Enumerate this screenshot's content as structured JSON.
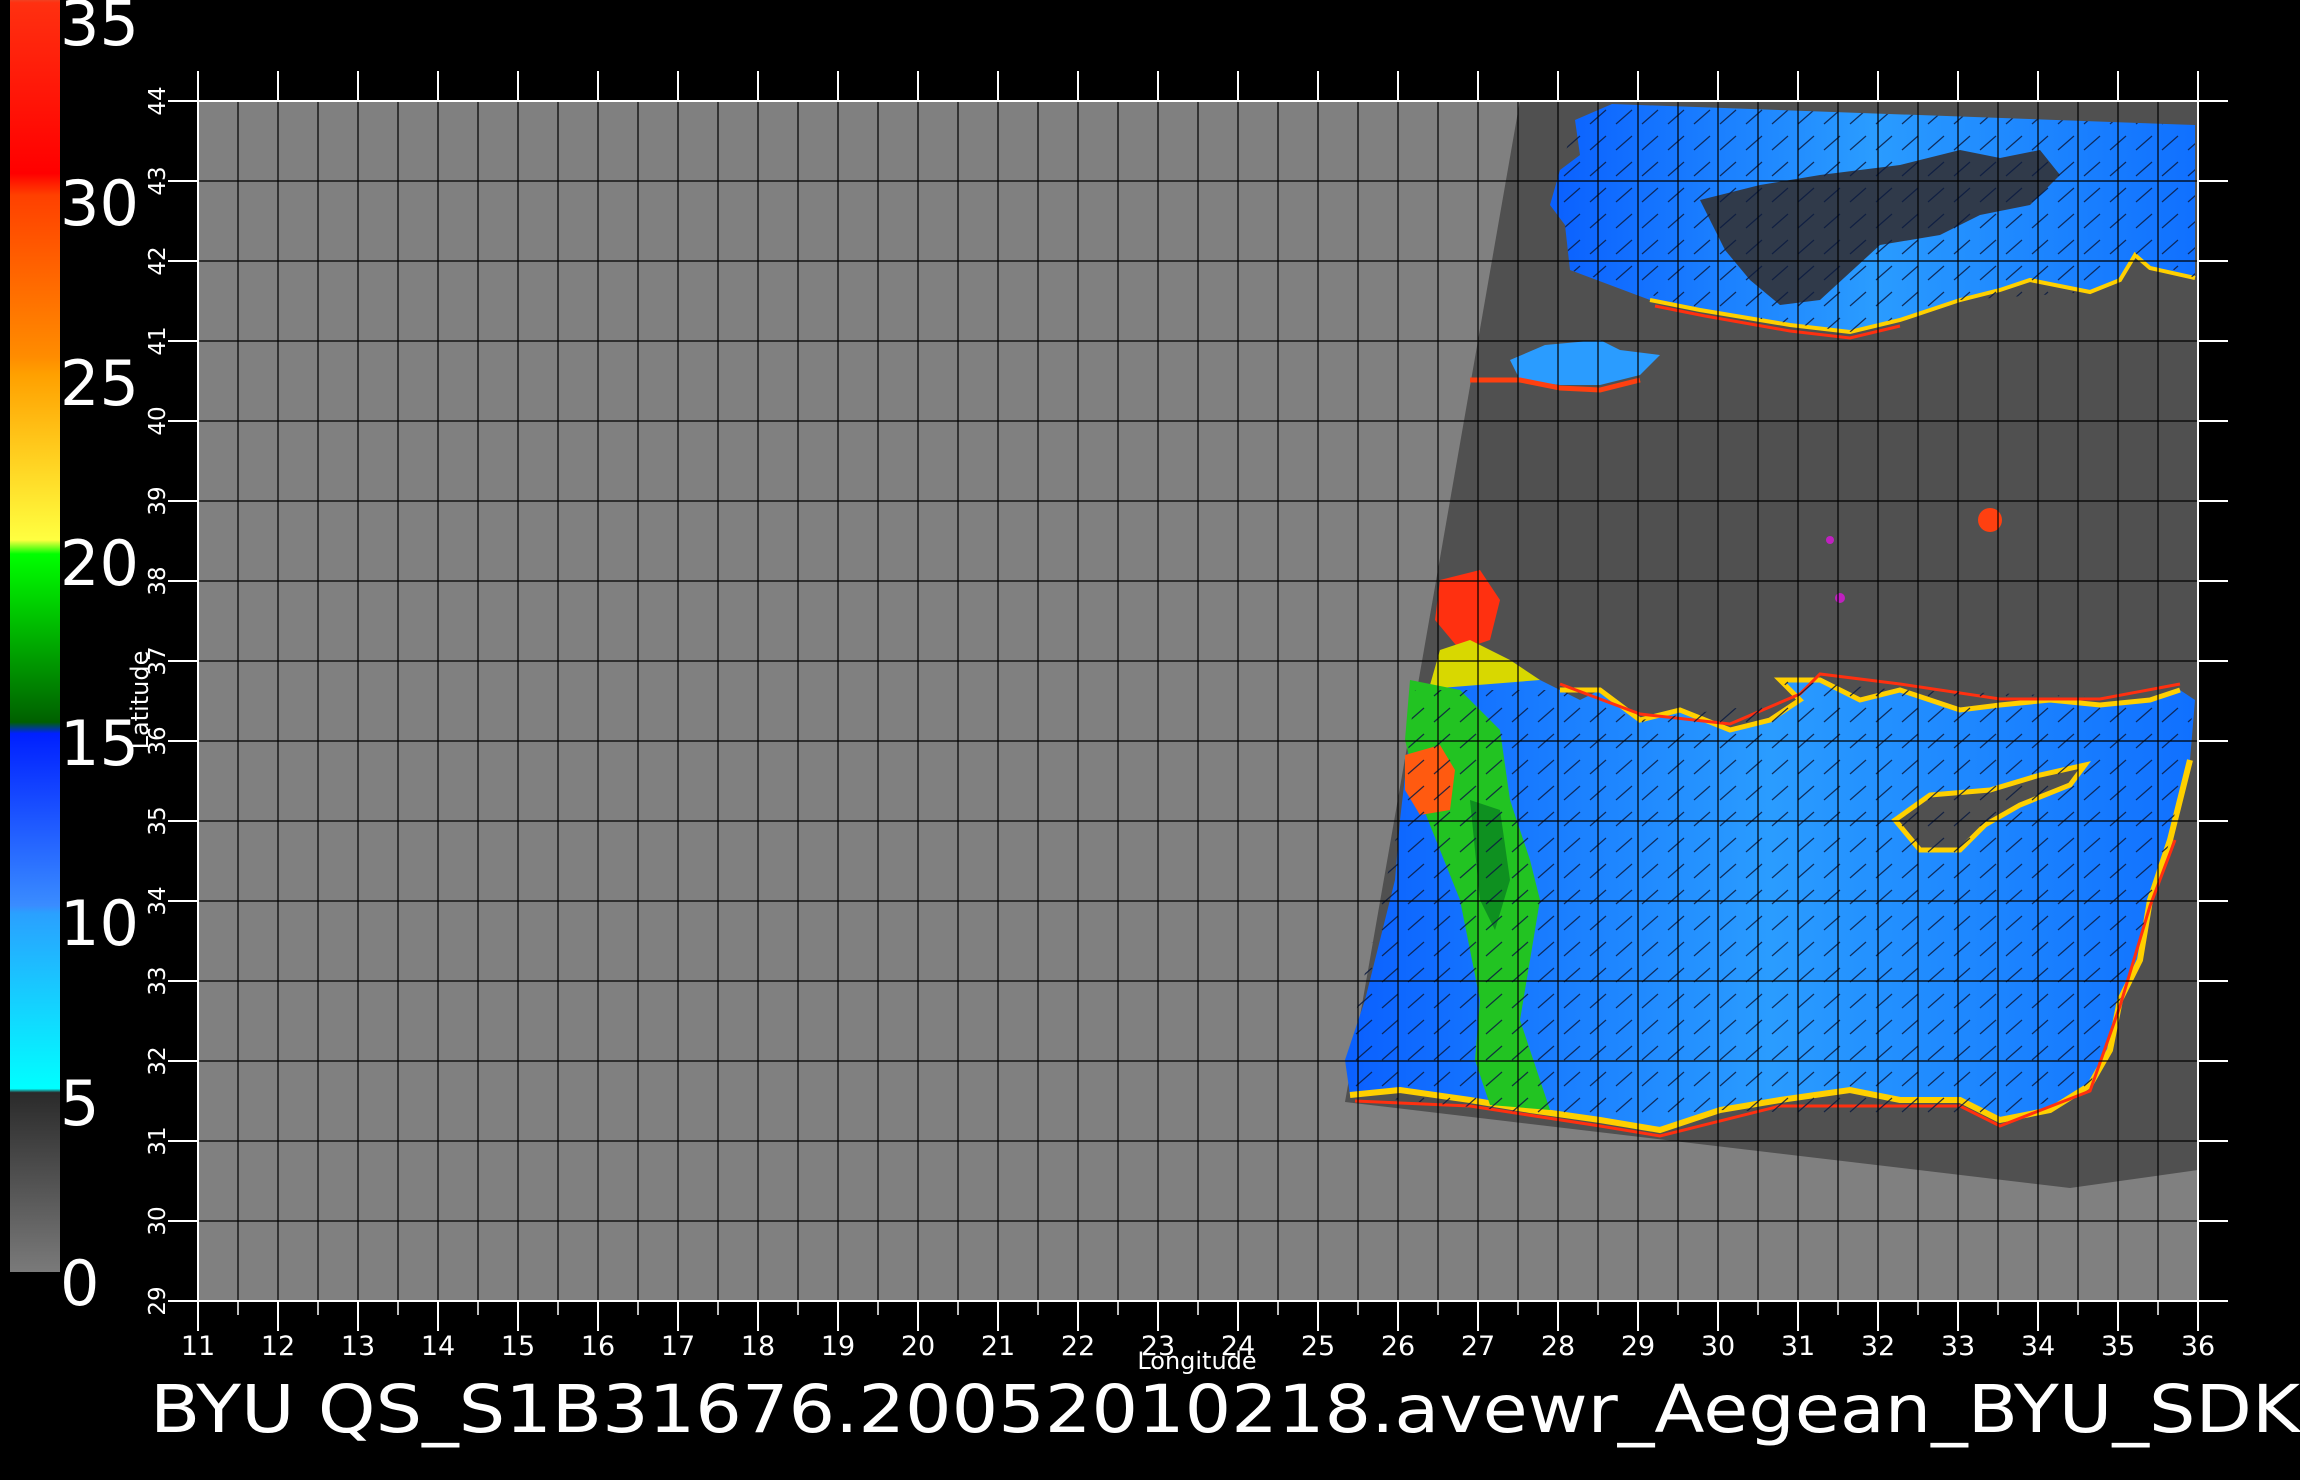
{
  "title": "BYU QS_S1B31676.20052010218.avewr_Aegean_BYU_SDK",
  "axes": {
    "x_label": "Longitude",
    "y_label": "Latitude",
    "x_ticks": [
      "11",
      "12",
      "13",
      "14",
      "15",
      "16",
      "17",
      "18",
      "19",
      "20",
      "21",
      "22",
      "23",
      "24",
      "25",
      "26",
      "27",
      "28",
      "29",
      "30",
      "31",
      "32",
      "33",
      "34",
      "35",
      "36"
    ],
    "y_ticks": [
      "29",
      "30",
      "31",
      "32",
      "33",
      "34",
      "35",
      "36",
      "37",
      "38",
      "39",
      "40",
      "41",
      "42",
      "43",
      "44"
    ],
    "lon_range": [
      11,
      36
    ],
    "lat_range": [
      29,
      44
    ]
  },
  "colorbar": {
    "labels": [
      "0",
      "5",
      "10",
      "15",
      "20",
      "25",
      "30",
      "35"
    ],
    "range": [
      0,
      35
    ],
    "stops": [
      {
        "from": 0,
        "to": 5,
        "colors": [
          "#7a7a7a",
          "#2a2a2a"
        ]
      },
      {
        "from": 5,
        "to": 10,
        "colors": [
          "#00ffff",
          "#2aa0ff"
        ]
      },
      {
        "from": 10,
        "to": 15,
        "colors": [
          "#3a8cff",
          "#0020ff"
        ]
      },
      {
        "from": 15,
        "to": 20,
        "colors": [
          "#006000",
          "#00ff00"
        ]
      },
      {
        "from": 20,
        "to": 25,
        "colors": [
          "#ffff40",
          "#ffa000"
        ]
      },
      {
        "from": 25,
        "to": 30,
        "colors": [
          "#ff8c00",
          "#ff4000"
        ]
      },
      {
        "from": 30,
        "to": 35,
        "colors": [
          "#ff0000",
          "#ff5020"
        ]
      },
      {
        "from": 35,
        "to": 36,
        "colors": [
          "#c08060",
          "#c08060"
        ]
      }
    ]
  },
  "colors": {
    "background": "#000000",
    "land_fill": "#808080",
    "swath_fill": "#505050",
    "grid": "#000000",
    "wind_low": "#2a9cff",
    "wind_mid": "#0a5cff",
    "wind_high": "#22c322",
    "coast_high": "#ff3010"
  }
}
